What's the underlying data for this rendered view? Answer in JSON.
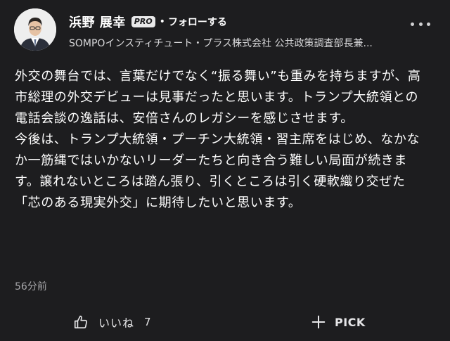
{
  "author": {
    "name": "浜野 展幸",
    "badge": "PRO",
    "separator": "•",
    "follow_label": "フォローする",
    "affiliation": "SOMPOインスティチュート・プラス株式会社 公共政策調査部長兼..."
  },
  "comment": {
    "paragraphs": [
      "外交の舞台では、言葉だけでなく“振る舞い”も重みを持ちますが、高市総理の外交デビューは見事だったと思います。トランプ大統領との電話会談の逸話は、安倍さんのレガシーを感じさせます。",
      "今後は、トランプ大統領・プーチン大統領・習主席をはじめ、なかなか一筋縄ではいかないリーダーたちと向き合う難しい局面が続きます。譲れないところは踏ん張り、引くところは引く硬軟織り交ぜた「芯のある現実外交」に期待したいと思います。"
    ],
    "timestamp": "56分前"
  },
  "actions": {
    "like_label": "いいね",
    "like_count": "7",
    "pick_label": "PICK"
  },
  "icons": {
    "more": "more-horizontal-icon",
    "like": "thumbs-up-icon",
    "pick": "plus-icon"
  },
  "colors": {
    "background": "#1d1d1f",
    "text_primary": "#ffffff",
    "text_secondary": "#a8a8ab"
  }
}
